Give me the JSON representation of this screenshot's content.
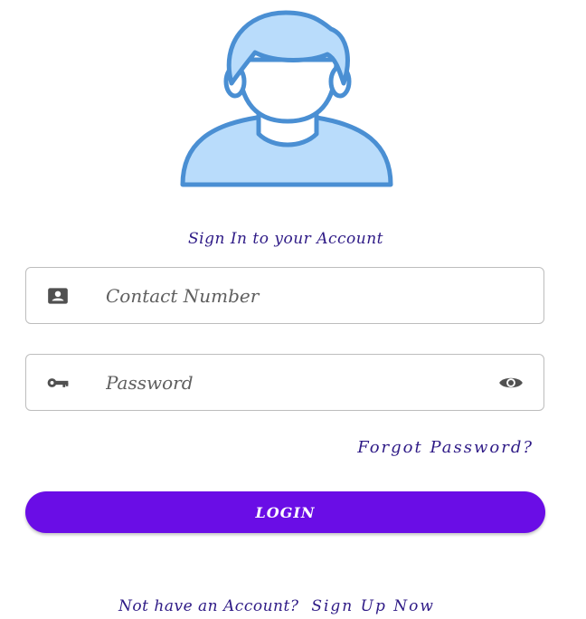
{
  "heading": "Sign In to your Account",
  "contact_field": {
    "icon": "contact-card-icon",
    "placeholder": "Contact Number",
    "value": ""
  },
  "password_field": {
    "icon": "key-icon",
    "placeholder": "Password",
    "value": "",
    "toggle_icon": "eye-icon"
  },
  "forgot_password": "Forgot Password?",
  "login_button": "LOGIN",
  "footer": {
    "prompt": "Not have an Account?",
    "signup_link": "Sign Up Now"
  },
  "colors": {
    "primary": "#6a0de6",
    "text_dark": "#2e1a86",
    "avatar_fill": "#b9dcfb",
    "avatar_stroke": "#4a8fd3",
    "icon_gray": "#505050"
  }
}
